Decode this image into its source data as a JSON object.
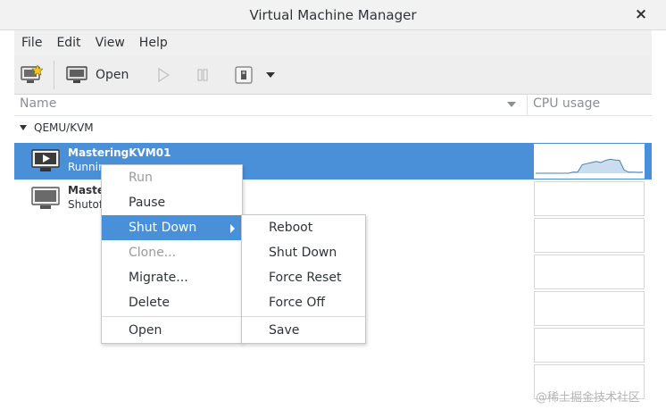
{
  "window": {
    "title": "Virtual Machine Manager",
    "close_glyph": "×"
  },
  "menubar": [
    "File",
    "Edit",
    "View",
    "Help"
  ],
  "toolbar": {
    "open_label": "Open"
  },
  "columns": {
    "name": "Name",
    "cpu": "CPU usage"
  },
  "group": {
    "label": "QEMU/KVM"
  },
  "vms": [
    {
      "name": "MasteringKVM01",
      "state": "Running",
      "selected": true
    },
    {
      "name": "Master",
      "state": "Shutoff",
      "selected": false
    }
  ],
  "context_menu": {
    "items": [
      {
        "label": "Run",
        "disabled": true
      },
      {
        "label": "Pause"
      },
      {
        "label": "Shut Down",
        "active": true,
        "submenu": true
      },
      {
        "label": "Clone...",
        "disabled": true
      },
      {
        "label": "Migrate..."
      },
      {
        "label": "Delete"
      },
      {
        "label": "Open"
      }
    ]
  },
  "submenu": {
    "items": [
      "Reboot",
      "Shut Down",
      "Force Reset",
      "Force Off",
      "Save"
    ]
  },
  "cpu_graph_selected": [
    0,
    0,
    0,
    0,
    0,
    0,
    0,
    0,
    0.05,
    0.05,
    0.4,
    0.45,
    0.5,
    0.55,
    0.5,
    0.6,
    0.65,
    0.62,
    0.6,
    0.15,
    0.05,
    0.05,
    0.04,
    0.05
  ],
  "watermark": "@稀土掘金技术社区",
  "colors": {
    "selection": "#4a90d9",
    "text": "#2e3436",
    "disabled": "#9a9a9a"
  }
}
